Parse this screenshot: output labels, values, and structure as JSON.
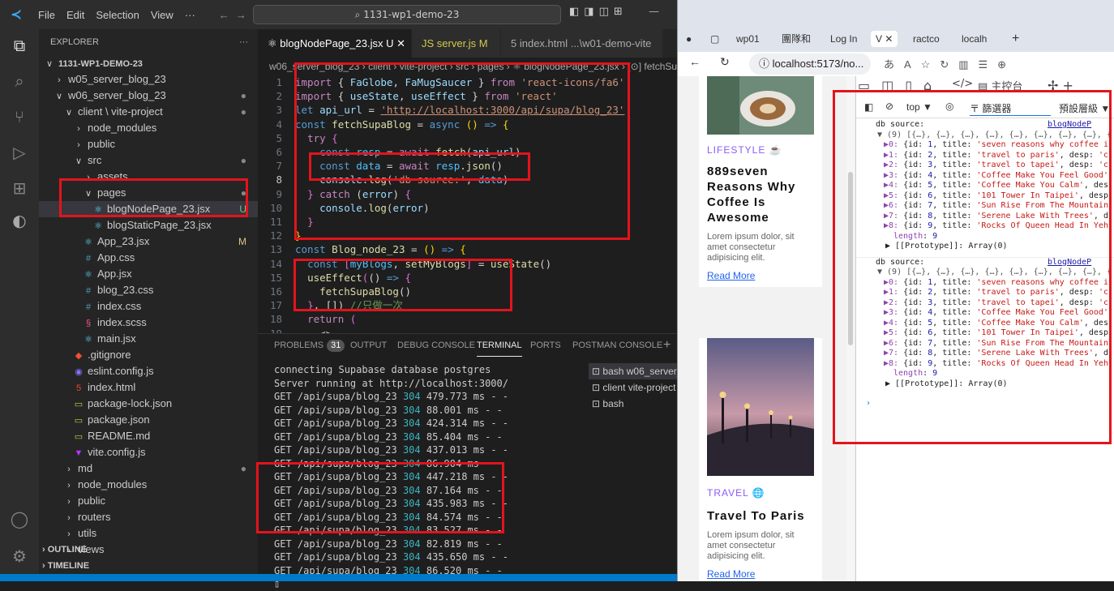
{
  "vscode": {
    "menu": [
      "File",
      "Edit",
      "Selection",
      "View",
      "···"
    ],
    "command_center": "⌕ 1131-wp1-demo-23",
    "explorer_title": "EXPLORER",
    "explorer_more": "···",
    "tree": [
      {
        "label": "1131-WP1-DEMO-23",
        "depth": 0,
        "icon": "∨",
        "badge": "",
        "sel": false
      },
      {
        "label": "w05_server_blog_23",
        "depth": 1,
        "icon": "›",
        "badge": "",
        "sel": false
      },
      {
        "label": "w06_server_blog_23",
        "depth": 1,
        "icon": "∨",
        "badge": "●",
        "sel": false
      },
      {
        "label": "client \\ vite-project",
        "depth": 2,
        "icon": "∨",
        "badge": "●",
        "sel": false
      },
      {
        "label": "node_modules",
        "depth": 3,
        "icon": "›",
        "badge": "",
        "sel": false
      },
      {
        "label": "public",
        "depth": 3,
        "icon": "›",
        "badge": "",
        "sel": false
      },
      {
        "label": "src",
        "depth": 3,
        "icon": "∨",
        "badge": "●",
        "sel": false
      },
      {
        "label": "assets",
        "depth": 4,
        "icon": "›",
        "badge": "",
        "sel": false
      },
      {
        "label": "pages",
        "depth": 4,
        "icon": "∨",
        "badge": "●",
        "sel": false
      },
      {
        "label": "blogNodePage_23.jsx",
        "depth": 5,
        "icon": "⚛",
        "badge": "U",
        "sel": true
      },
      {
        "label": "blogStaticPage_23.jsx",
        "depth": 5,
        "icon": "⚛",
        "badge": "",
        "sel": false
      },
      {
        "label": "App_23.jsx",
        "depth": 4,
        "icon": "⚛",
        "badge": "M",
        "sel": false
      },
      {
        "label": "App.css",
        "depth": 4,
        "icon": "#",
        "badge": "",
        "sel": false
      },
      {
        "label": "App.jsx",
        "depth": 4,
        "icon": "⚛",
        "badge": "",
        "sel": false
      },
      {
        "label": "blog_23.css",
        "depth": 4,
        "icon": "#",
        "badge": "",
        "sel": false
      },
      {
        "label": "index.css",
        "depth": 4,
        "icon": "#",
        "badge": "",
        "sel": false
      },
      {
        "label": "index.scss",
        "depth": 4,
        "icon": "§",
        "badge": "",
        "sel": false
      },
      {
        "label": "main.jsx",
        "depth": 4,
        "icon": "⚛",
        "badge": "",
        "sel": false
      },
      {
        "label": ".gitignore",
        "depth": 3,
        "icon": "◆",
        "badge": "",
        "sel": false
      },
      {
        "label": "eslint.config.js",
        "depth": 3,
        "icon": "◉",
        "badge": "",
        "sel": false
      },
      {
        "label": "index.html",
        "depth": 3,
        "icon": "5",
        "badge": "",
        "sel": false
      },
      {
        "label": "package-lock.json",
        "depth": 3,
        "icon": "▭",
        "badge": "",
        "sel": false
      },
      {
        "label": "package.json",
        "depth": 3,
        "icon": "▭",
        "badge": "",
        "sel": false
      },
      {
        "label": "README.md",
        "depth": 3,
        "icon": "▭",
        "badge": "",
        "sel": false
      },
      {
        "label": "vite.config.js",
        "depth": 3,
        "icon": "▼",
        "badge": "",
        "sel": false
      },
      {
        "label": "md",
        "depth": 2,
        "icon": "›",
        "badge": "●",
        "sel": false
      },
      {
        "label": "node_modules",
        "depth": 2,
        "icon": "›",
        "badge": "",
        "sel": false
      },
      {
        "label": "public",
        "depth": 2,
        "icon": "›",
        "badge": "",
        "sel": false
      },
      {
        "label": "routers",
        "depth": 2,
        "icon": "›",
        "badge": "",
        "sel": false
      },
      {
        "label": "utils",
        "depth": 2,
        "icon": "›",
        "badge": "",
        "sel": false
      },
      {
        "label": "views",
        "depth": 2,
        "icon": "›",
        "badge": "",
        "sel": false
      }
    ],
    "outline": "OUTLINE",
    "timeline": "TIMELINE",
    "tabs": [
      {
        "label": "⚛ blogNodePage_23.jsx U ✕",
        "active": true
      },
      {
        "label": "JS server.js M",
        "active": false
      },
      {
        "label": "5 index.html ...\\w01-demo-vite",
        "active": false
      }
    ],
    "breadcrumb": "w06_server_blog_23 › client › vite-project › src › pages › ⚛ blogNodePage_23.jsx › [⊙] fetchSu",
    "code_lines": [
      {
        "n": "1",
        "html": "<span class=\"kw\">import</span> <span class=\"pn\">{ </span><span class=\"vr\">FaGlobe</span><span class=\"pn\">, </span><span class=\"vr\">FaMugSaucer</span><span class=\"pn\"> } </span><span class=\"kw\">from</span> <span class=\"str\">'react-icons/fa6'</span>"
      },
      {
        "n": "2",
        "html": "<span class=\"kw\">import</span> <span class=\"pn\">{ </span><span class=\"vr\">useState</span><span class=\"pn\">, </span><span class=\"vr\">useEffect</span><span class=\"pn\"> } </span><span class=\"kw\">from</span> <span class=\"str\">'react'</span>"
      },
      {
        "n": "3",
        "html": "<span class=\"kw2\">let</span> <span class=\"vr\">api_url</span> <span class=\"pn\">= </span><span class=\"url\">'http://localhost:3000/api/supa/blog_23'</span>"
      },
      {
        "n": "4",
        "html": "<span class=\"kw2\">const</span> <span class=\"fn\">fetchSupaBlog</span> <span class=\"pn\">= </span><span class=\"kw2\">async</span> <span class=\"br\">()</span> <span class=\"kw2\">=&gt;</span> <span class=\"br\">{</span>"
      },
      {
        "n": "5",
        "html": "  <span class=\"kw\">try</span> <span class=\"br2\">{</span>"
      },
      {
        "n": "6",
        "html": "    <span class=\"kw2\">const</span> <span class=\"ct\">resp</span> <span class=\"pn\">= </span><span class=\"kw\">await</span> <span class=\"fn\">fetch</span><span class=\"pn\">(</span><span class=\"vr\">api_url</span><span class=\"pn\">)</span>"
      },
      {
        "n": "7",
        "html": "    <span class=\"kw2\">const</span> <span class=\"ct\">data</span> <span class=\"pn\">= </span><span class=\"kw\">await</span> <span class=\"ct\">resp</span><span class=\"pn\">.</span><span class=\"fn\">json</span><span class=\"pn\">()</span>"
      },
      {
        "n": "8",
        "html": "    <span class=\"vr\">console</span><span class=\"pn\">.</span><span class=\"fn\">log</span><span class=\"pn\">(</span><span class=\"str\">'db source:'</span><span class=\"pn\">, </span><span class=\"ct\">data</span><span class=\"pn\">)</span>",
        "cur": true
      },
      {
        "n": "9",
        "html": "  <span class=\"br2\">}</span> <span class=\"kw\">catch</span> <span class=\"pn\">(</span><span class=\"vr\">error</span><span class=\"pn\">) </span><span class=\"br2\">{</span>"
      },
      {
        "n": "10",
        "html": "    <span class=\"vr\">console</span><span class=\"pn\">.</span><span class=\"fn\">log</span><span class=\"pn\">(</span><span class=\"vr\">error</span><span class=\"pn\">)</span>"
      },
      {
        "n": "11",
        "html": "  <span class=\"br2\">}</span>"
      },
      {
        "n": "12",
        "html": "<span class=\"br\">}</span>"
      },
      {
        "n": "13",
        "html": "<span class=\"kw2\">const</span> <span class=\"fn\">Blog_node_23</span> <span class=\"pn\">= </span><span class=\"br\">()</span> <span class=\"kw2\">=&gt;</span> <span class=\"br\">{</span>"
      },
      {
        "n": "14",
        "html": "  <span class=\"kw2\">const</span> <span class=\"br2\">[</span><span class=\"ct\">myBlogs</span><span class=\"pn\">, </span><span class=\"fn\">setMyBlogs</span><span class=\"br2\">]</span> <span class=\"pn\">= </span><span class=\"fn\">useState</span><span class=\"pn\">()</span>"
      },
      {
        "n": "15",
        "html": "  <span class=\"fn\">useEffect</span><span class=\"br2\">(</span><span class=\"pn\">() </span><span class=\"kw2\">=&gt;</span> <span class=\"br2\">{</span>"
      },
      {
        "n": "16",
        "html": "    <span class=\"fn\">fetchSupaBlog</span><span class=\"pn\">()</span>"
      },
      {
        "n": "17",
        "html": "  <span class=\"br2\">}</span><span class=\"pn\">, [])</span> <span class=\"cm\">//只做一次</span>"
      },
      {
        "n": "18",
        "html": "  <span class=\"kw\">return</span> <span class=\"br2\">(</span>"
      },
      {
        "n": "19",
        "html": "    <span class=\"pn\">&lt;&gt;</span>"
      }
    ],
    "panel_tabs": [
      {
        "label": "PROBLEMS",
        "badge": "31",
        "active": false
      },
      {
        "label": "OUTPUT",
        "active": false
      },
      {
        "label": "DEBUG CONSOLE",
        "active": false
      },
      {
        "label": "TERMINAL",
        "active": true
      },
      {
        "label": "PORTS",
        "active": false
      },
      {
        "label": "POSTMAN CONSOLE",
        "active": false
      },
      {
        "label": "+",
        "active": false
      }
    ],
    "terminal_lines": [
      {
        "t": "connecting Supabase database postgres"
      },
      {
        "t": "Server running at http://localhost:3000/"
      },
      {
        "t": "GET /api/supa/blog_23 ",
        "c": "304",
        "r": " 479.773 ms - -"
      },
      {
        "t": "GET /api/supa/blog_23 ",
        "c": "304",
        "r": " 88.001 ms - -"
      },
      {
        "t": "GET /api/supa/blog_23 ",
        "c": "304",
        "r": " 424.314 ms - -"
      },
      {
        "t": "GET /api/supa/blog_23 ",
        "c": "304",
        "r": " 85.404 ms - -"
      },
      {
        "t": "GET /api/supa/blog_23 ",
        "c": "304",
        "r": " 437.013 ms - -"
      },
      {
        "t": "GET /api/supa/blog_23 ",
        "c": "304",
        "r": " 86.904 ms - -"
      },
      {
        "t": "GET /api/supa/blog_23 ",
        "c": "304",
        "r": " 447.218 ms - -"
      },
      {
        "t": "GET /api/supa/blog_23 ",
        "c": "304",
        "r": " 87.164 ms - -"
      },
      {
        "t": "GET /api/supa/blog_23 ",
        "c": "304",
        "r": " 435.983 ms - -"
      },
      {
        "t": "GET /api/supa/blog_23 ",
        "c": "304",
        "r": " 84.574 ms - -"
      },
      {
        "t": "GET /api/supa/blog_23 ",
        "c": "304",
        "r": " 83.527 ms - -"
      },
      {
        "t": "GET /api/supa/blog_23 ",
        "c": "304",
        "r": " 82.819 ms - -"
      },
      {
        "t": "GET /api/supa/blog_23 ",
        "c": "304",
        "r": " 435.650 ms - -"
      },
      {
        "t": "GET /api/supa/blog_23 ",
        "c": "304",
        "r": " 86.520 ms - -"
      },
      {
        "t": "▯"
      }
    ],
    "terminal_list": [
      "⊡ bash w06_server_b",
      "⊡ client vite-project",
      "⊡ bash"
    ]
  },
  "browser": {
    "tabs": [
      "wp01",
      "團隊和",
      "Log In",
      "V ✕",
      "ractco",
      "localh",
      "+"
    ],
    "url": "localhost:5173/no...",
    "cards": [
      {
        "category": "LIFESTYLE ☕",
        "title_lines": [
          "889seven",
          "Reasons Why",
          "Coffee Is",
          "Awesome"
        ],
        "text_lines": [
          "Lorem ipsum dolor, sit",
          "amet consectetur",
          "adipisicing elit."
        ],
        "more": "Read More"
      },
      {
        "category": "TRAVEL 🌐",
        "title_lines": [
          "Travel To Paris"
        ],
        "text_lines": [
          "Lorem ipsum dolor, sit",
          "amet consectetur",
          "adipisicing elit."
        ],
        "more": "Read More"
      }
    ],
    "devtools": {
      "top_label": "top ▼",
      "filter": "〒 篩選器",
      "level": "預設層級 ▼",
      "logs": [
        {
          "source": "db source:",
          "link": "blogNodeP",
          "summary": "▼ (9) [{…}, {…}, {…}, {…}, {…}, {…}, {…}, {…}, {",
          "rows": [
            "▶0: {id: 1, title: 'seven reasons why coffee i",
            "▶1: {id: 2, title: 'travel to paris', desp: 'c",
            "▶2: {id: 3, title: 'travel to tapei', desp: 'c",
            "▶3: {id: 4, title: 'Coffee Make You Feel Good'",
            "▶4: {id: 5, title: 'Coffee Make You Calm', des",
            "▶5: {id: 6, title: '101 Tower In Taipei', desp",
            "▶6: {id: 7, title: 'Sun Rise From The Mountain",
            "▶7: {id: 8, title: 'Serene Lake With Trees', d",
            "▶8: {id: 9, title: 'Rocks Of Queen Head In Yeh"
          ],
          "length": "length: 9",
          "proto": "▶ [[Prototype]]: Array(0)"
        },
        {
          "source": "db source:",
          "link": "blogNodeP",
          "summary": "▼ (9) [{…}, {…}, {…}, {…}, {…}, {…}, {…}, {…}, {",
          "rows": [
            "▶0: {id: 1, title: 'seven reasons why coffee i",
            "▶1: {id: 2, title: 'travel to paris', desp: 'c",
            "▶2: {id: 3, title: 'travel to tapei', desp: 'c",
            "▶3: {id: 4, title: 'Coffee Make You Feel Good'",
            "▶4: {id: 5, title: 'Coffee Make You Calm', des",
            "▶5: {id: 6, title: '101 Tower In Taipei', desp",
            "▶6: {id: 7, title: 'Sun Rise From The Mountain",
            "▶7: {id: 8, title: 'Serene Lake With Trees', d",
            "▶8: {id: 9, title: 'Rocks Of Queen Head In Yeh"
          ],
          "length": "length: 9",
          "proto": "▶ [[Prototype]]: Array(0)"
        }
      ],
      "prompt": "›"
    }
  }
}
